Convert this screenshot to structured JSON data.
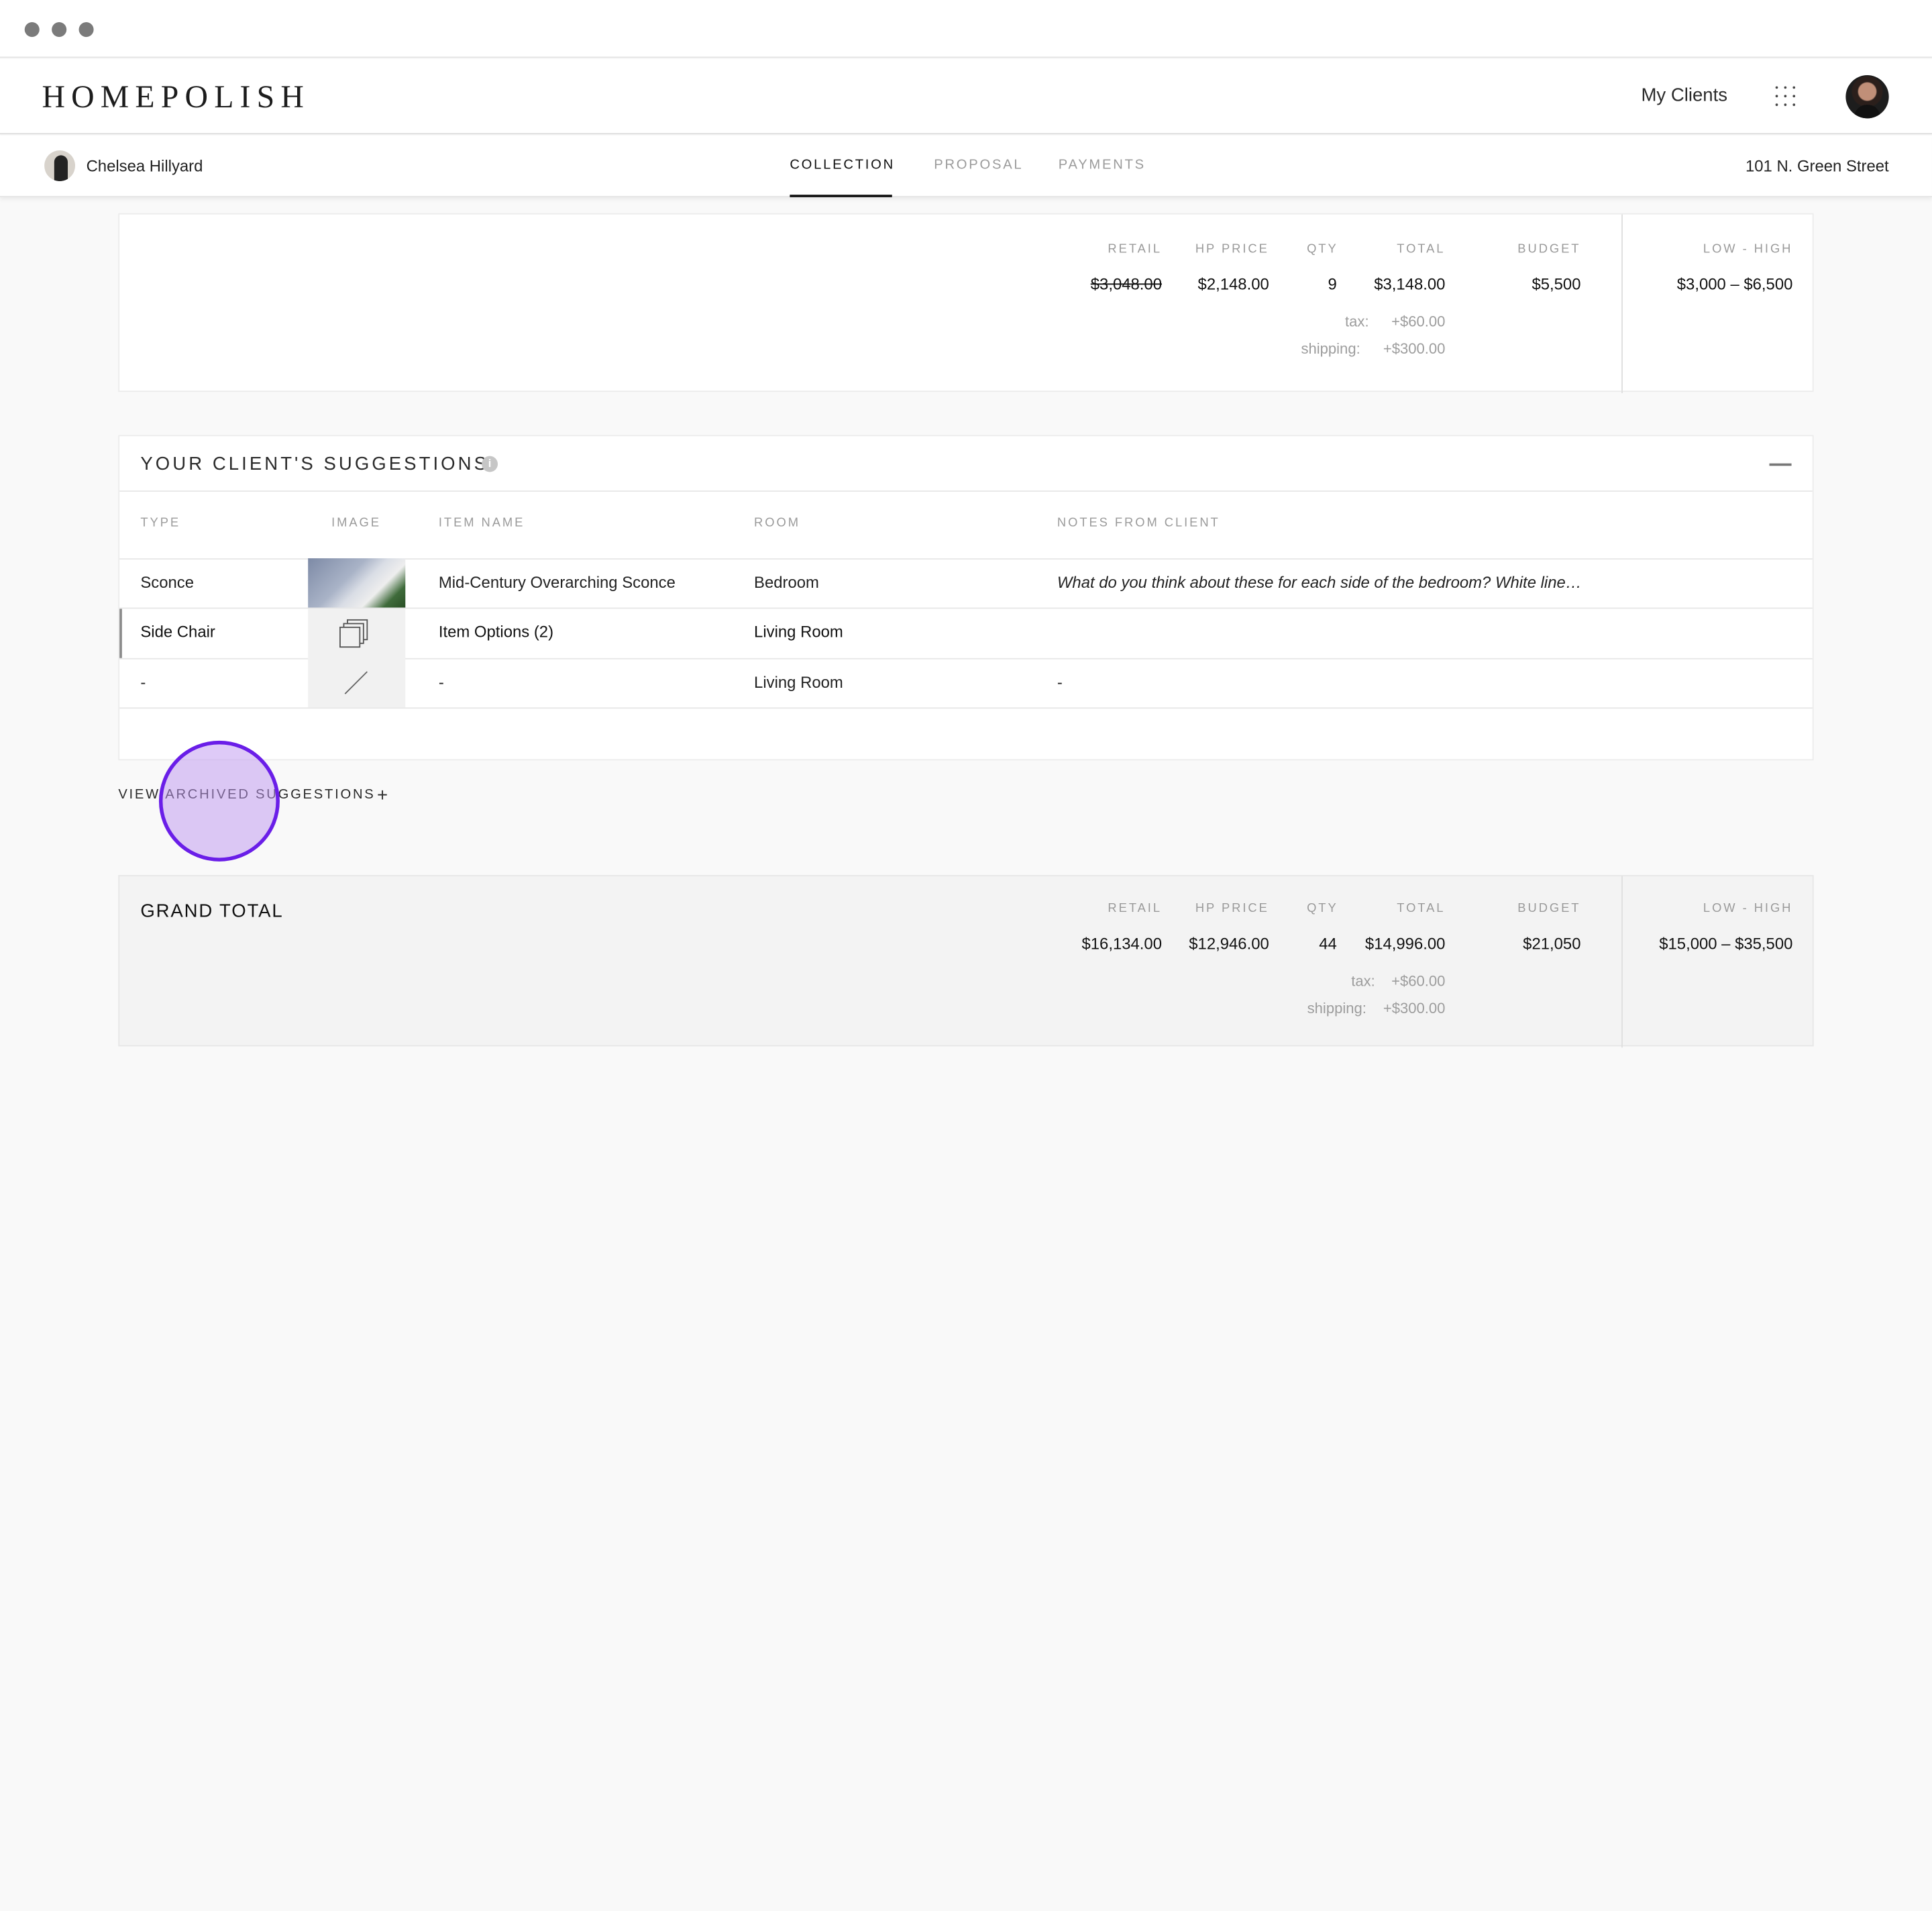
{
  "app": {
    "logo": "HOMEPOLISH"
  },
  "header": {
    "my_clients": "My Clients"
  },
  "subnav": {
    "client_name": "Chelsea Hillyard",
    "tabs": [
      "COLLECTION",
      "PROPOSAL",
      "PAYMENTS"
    ],
    "active_tab": "COLLECTION",
    "address": "101 N. Green Street"
  },
  "summary": {
    "headers": {
      "retail": "RETAIL",
      "hp_price": "HP PRICE",
      "qty": "QTY",
      "total": "TOTAL",
      "budget": "BUDGET",
      "range": "LOW - HIGH"
    },
    "retail": "$3,048.00",
    "hp_price": "$2,148.00",
    "qty": "9",
    "total": "$3,148.00",
    "budget": "$5,500",
    "range": "$3,000 – $6,500",
    "tax_label": "tax:",
    "tax": "+$60.00",
    "shipping_label": "shipping:",
    "shipping": "+$300.00"
  },
  "suggestions": {
    "title": "YOUR CLIENT'S SUGGESTIONS",
    "columns": [
      "TYPE",
      "IMAGE",
      "ITEM NAME",
      "ROOM",
      "NOTES FROM CLIENT"
    ],
    "rows": [
      {
        "type": "Sconce",
        "item": "Mid-Century Overarching Sconce",
        "room": "Bedroom",
        "notes": "What do you think about these for each side of the bedroom? White line…"
      },
      {
        "type": "Side Chair",
        "item": "Item Options (2)",
        "room": "Living Room",
        "notes": ""
      },
      {
        "type": "-",
        "item": "-",
        "room": "Living Room",
        "notes": "-"
      }
    ],
    "archived_link": "VIEW ARCHIVED SUGGESTIONS",
    "archived_plus": "+"
  },
  "grand_total": {
    "title": "GRAND TOTAL",
    "retail": "$16,134.00",
    "hp_price": "$12,946.00",
    "qty": "44",
    "total": "$14,996.00",
    "budget": "$21,050",
    "range": "$15,000 – $35,500",
    "tax_label": "tax:",
    "tax": "+$60.00",
    "shipping_label": "shipping:",
    "shipping": "+$300.00"
  }
}
